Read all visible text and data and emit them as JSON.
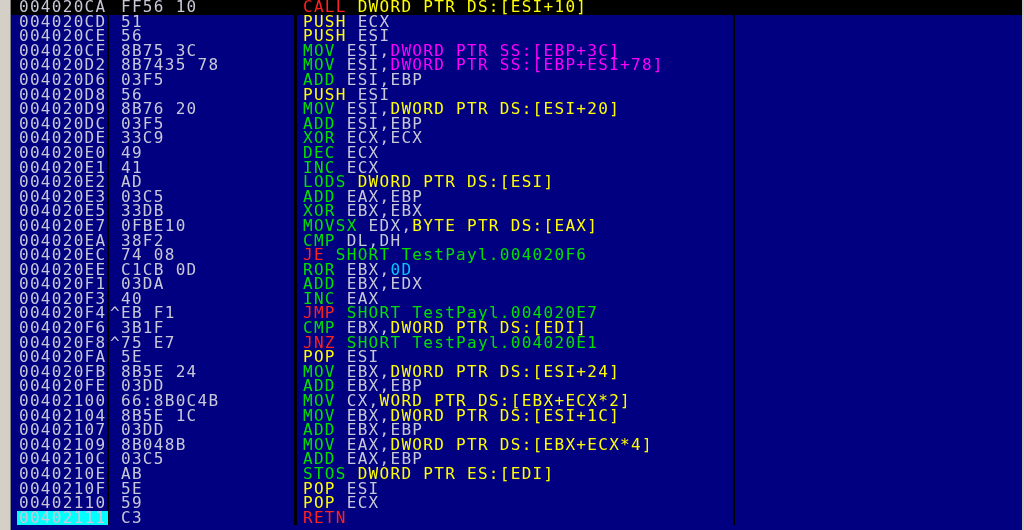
{
  "rows": [
    {
      "address": "004020CA",
      "hex": "FF56 10",
      "mnemonic": {
        "text": "CALL",
        "kind": "call"
      },
      "operands": [
        {
          "text": "DWORD PTR DS:[ESI+10]",
          "kind": "mem"
        }
      ],
      "selected": true,
      "eip": false
    },
    {
      "address": "004020CD",
      "hex": "51",
      "mnemonic": {
        "text": "PUSH",
        "kind": "stack"
      },
      "operands": [
        {
          "text": "ECX",
          "kind": "reg"
        }
      ],
      "selected": false,
      "eip": false
    },
    {
      "address": "004020CE",
      "hex": "56",
      "mnemonic": {
        "text": "PUSH",
        "kind": "stack"
      },
      "operands": [
        {
          "text": "ESI",
          "kind": "reg"
        }
      ],
      "selected": false,
      "eip": false
    },
    {
      "address": "004020CF",
      "hex": "8B75 3C",
      "mnemonic": {
        "text": "MOV",
        "kind": "other"
      },
      "operands": [
        {
          "text": "ESI,",
          "kind": "reg"
        },
        {
          "text": "DWORD PTR SS:[EBP+3C]",
          "kind": "stack_mem"
        }
      ],
      "selected": false,
      "eip": false
    },
    {
      "address": "004020D2",
      "hex": "8B7435 78",
      "mnemonic": {
        "text": "MOV",
        "kind": "other"
      },
      "operands": [
        {
          "text": "ESI,",
          "kind": "reg"
        },
        {
          "text": "DWORD PTR SS:[EBP+ESI+78]",
          "kind": "stack_mem"
        }
      ],
      "selected": false,
      "eip": false
    },
    {
      "address": "004020D6",
      "hex": "03F5",
      "mnemonic": {
        "text": "ADD",
        "kind": "other"
      },
      "operands": [
        {
          "text": "ESI,EBP",
          "kind": "reg"
        }
      ],
      "selected": false,
      "eip": false
    },
    {
      "address": "004020D8",
      "hex": "56",
      "mnemonic": {
        "text": "PUSH",
        "kind": "stack"
      },
      "operands": [
        {
          "text": "ESI",
          "kind": "reg"
        }
      ],
      "selected": false,
      "eip": false
    },
    {
      "address": "004020D9",
      "hex": "8B76 20",
      "mnemonic": {
        "text": "MOV",
        "kind": "other"
      },
      "operands": [
        {
          "text": "ESI,",
          "kind": "reg"
        },
        {
          "text": "DWORD PTR DS:[ESI+20]",
          "kind": "mem"
        }
      ],
      "selected": false,
      "eip": false
    },
    {
      "address": "004020DC",
      "hex": "03F5",
      "mnemonic": {
        "text": "ADD",
        "kind": "other"
      },
      "operands": [
        {
          "text": "ESI,EBP",
          "kind": "reg"
        }
      ],
      "selected": false,
      "eip": false
    },
    {
      "address": "004020DE",
      "hex": "33C9",
      "mnemonic": {
        "text": "XOR",
        "kind": "other"
      },
      "operands": [
        {
          "text": "ECX,ECX",
          "kind": "reg"
        }
      ],
      "selected": false,
      "eip": false
    },
    {
      "address": "004020E0",
      "hex": "49",
      "mnemonic": {
        "text": "DEC",
        "kind": "other"
      },
      "operands": [
        {
          "text": "ECX",
          "kind": "reg"
        }
      ],
      "selected": false,
      "eip": false
    },
    {
      "address": "004020E1",
      "hex": "41",
      "mnemonic": {
        "text": "INC",
        "kind": "other"
      },
      "operands": [
        {
          "text": "ECX",
          "kind": "reg"
        }
      ],
      "selected": false,
      "eip": false
    },
    {
      "address": "004020E2",
      "hex": "AD",
      "mnemonic": {
        "text": "LODS",
        "kind": "other"
      },
      "operands": [
        {
          "text": "DWORD PTR DS:[ESI]",
          "kind": "mem"
        }
      ],
      "selected": false,
      "eip": false
    },
    {
      "address": "004020E3",
      "hex": "03C5",
      "mnemonic": {
        "text": "ADD",
        "kind": "other"
      },
      "operands": [
        {
          "text": "EAX,EBP",
          "kind": "reg"
        }
      ],
      "selected": false,
      "eip": false
    },
    {
      "address": "004020E5",
      "hex": "33DB",
      "mnemonic": {
        "text": "XOR",
        "kind": "other"
      },
      "operands": [
        {
          "text": "EBX,EBX",
          "kind": "reg"
        }
      ],
      "selected": false,
      "eip": false
    },
    {
      "address": "004020E7",
      "hex": "0FBE10",
      "mnemonic": {
        "text": "MOVSX",
        "kind": "other"
      },
      "operands": [
        {
          "text": "EDX,",
          "kind": "reg"
        },
        {
          "text": "BYTE PTR DS:[EAX]",
          "kind": "mem"
        }
      ],
      "selected": false,
      "eip": false
    },
    {
      "address": "004020EA",
      "hex": "38F2",
      "mnemonic": {
        "text": "CMP",
        "kind": "other"
      },
      "operands": [
        {
          "text": "DL,DH",
          "kind": "reg"
        }
      ],
      "selected": false,
      "eip": false
    },
    {
      "address": "004020EC",
      "hex": "74 08",
      "mnemonic": {
        "text": "JE",
        "kind": "jump"
      },
      "operands": [
        {
          "text": "SHORT TestPayl.004020F6",
          "kind": "target"
        }
      ],
      "selected": false,
      "eip": false
    },
    {
      "address": "004020EE",
      "hex": "C1CB 0D",
      "mnemonic": {
        "text": "ROR",
        "kind": "other"
      },
      "operands": [
        {
          "text": "EBX,",
          "kind": "reg"
        },
        {
          "text": "0D",
          "kind": "const"
        }
      ],
      "selected": false,
      "eip": false
    },
    {
      "address": "004020F1",
      "hex": "03DA",
      "mnemonic": {
        "text": "ADD",
        "kind": "other"
      },
      "operands": [
        {
          "text": "EBX,EDX",
          "kind": "reg"
        }
      ],
      "selected": false,
      "eip": false
    },
    {
      "address": "004020F3",
      "hex": "40",
      "mnemonic": {
        "text": "INC",
        "kind": "other"
      },
      "operands": [
        {
          "text": "EAX",
          "kind": "reg"
        }
      ],
      "selected": false,
      "eip": false
    },
    {
      "address": "004020F4",
      "jump_mark": "^",
      "hex": "EB F1",
      "mnemonic": {
        "text": "JMP",
        "kind": "jump"
      },
      "operands": [
        {
          "text": "SHORT TestPayl.004020E7",
          "kind": "target"
        }
      ],
      "selected": false,
      "eip": false
    },
    {
      "address": "004020F6",
      "hex": "3B1F",
      "mnemonic": {
        "text": "CMP",
        "kind": "other"
      },
      "operands": [
        {
          "text": "EBX,",
          "kind": "reg"
        },
        {
          "text": "DWORD PTR DS:[EDI]",
          "kind": "mem"
        }
      ],
      "selected": false,
      "eip": false
    },
    {
      "address": "004020F8",
      "jump_mark": "^",
      "hex": "75 E7",
      "mnemonic": {
        "text": "JNZ",
        "kind": "jump"
      },
      "operands": [
        {
          "text": "SHORT TestPayl.004020E1",
          "kind": "target"
        }
      ],
      "selected": false,
      "eip": false
    },
    {
      "address": "004020FA",
      "hex": "5E",
      "mnemonic": {
        "text": "POP",
        "kind": "stack"
      },
      "operands": [
        {
          "text": "ESI",
          "kind": "reg"
        }
      ],
      "selected": false,
      "eip": false
    },
    {
      "address": "004020FB",
      "hex": "8B5E 24",
      "mnemonic": {
        "text": "MOV",
        "kind": "other"
      },
      "operands": [
        {
          "text": "EBX,",
          "kind": "reg"
        },
        {
          "text": "DWORD PTR DS:[ESI+24]",
          "kind": "mem"
        }
      ],
      "selected": false,
      "eip": false
    },
    {
      "address": "004020FE",
      "hex": "03DD",
      "mnemonic": {
        "text": "ADD",
        "kind": "other"
      },
      "operands": [
        {
          "text": "EBX,EBP",
          "kind": "reg"
        }
      ],
      "selected": false,
      "eip": false
    },
    {
      "address": "00402100",
      "hex": "66:8B0C4B",
      "mnemonic": {
        "text": "MOV",
        "kind": "other"
      },
      "operands": [
        {
          "text": "CX,",
          "kind": "reg"
        },
        {
          "text": "WORD PTR DS:[EBX+ECX*2]",
          "kind": "mem"
        }
      ],
      "selected": false,
      "eip": false
    },
    {
      "address": "00402104",
      "hex": "8B5E 1C",
      "mnemonic": {
        "text": "MOV",
        "kind": "other"
      },
      "operands": [
        {
          "text": "EBX,",
          "kind": "reg"
        },
        {
          "text": "DWORD PTR DS:[ESI+1C]",
          "kind": "mem"
        }
      ],
      "selected": false,
      "eip": false
    },
    {
      "address": "00402107",
      "hex": "03DD",
      "mnemonic": {
        "text": "ADD",
        "kind": "other"
      },
      "operands": [
        {
          "text": "EBX,EBP",
          "kind": "reg"
        }
      ],
      "selected": false,
      "eip": false
    },
    {
      "address": "00402109",
      "hex": "8B048B",
      "mnemonic": {
        "text": "MOV",
        "kind": "other"
      },
      "operands": [
        {
          "text": "EAX,",
          "kind": "reg"
        },
        {
          "text": "DWORD PTR DS:[EBX+ECX*4]",
          "kind": "mem"
        }
      ],
      "selected": false,
      "eip": false
    },
    {
      "address": "0040210C",
      "hex": "03C5",
      "mnemonic": {
        "text": "ADD",
        "kind": "other"
      },
      "operands": [
        {
          "text": "EAX,EBP",
          "kind": "reg"
        }
      ],
      "selected": false,
      "eip": false
    },
    {
      "address": "0040210E",
      "hex": "AB",
      "mnemonic": {
        "text": "STOS",
        "kind": "other"
      },
      "operands": [
        {
          "text": "DWORD PTR ES:[EDI]",
          "kind": "mem"
        }
      ],
      "selected": false,
      "eip": false
    },
    {
      "address": "0040210F",
      "hex": "5E",
      "mnemonic": {
        "text": "POP",
        "kind": "stack"
      },
      "operands": [
        {
          "text": "ESI",
          "kind": "reg"
        }
      ],
      "selected": false,
      "eip": false
    },
    {
      "address": "00402110",
      "hex": "59",
      "mnemonic": {
        "text": "POP",
        "kind": "stack"
      },
      "operands": [
        {
          "text": "ECX",
          "kind": "reg"
        }
      ],
      "selected": false,
      "eip": false
    },
    {
      "address": "00402111",
      "hex": "C3",
      "mnemonic": {
        "text": "RETN",
        "kind": "call"
      },
      "operands": [],
      "selected": false,
      "eip": true
    }
  ]
}
